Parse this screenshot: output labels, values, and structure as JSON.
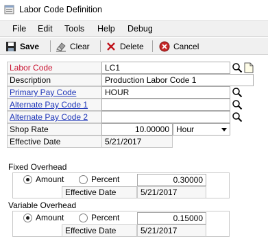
{
  "window": {
    "title": "Labor Code Definition"
  },
  "menu": {
    "file": "File",
    "edit": "Edit",
    "tools": "Tools",
    "help": "Help",
    "debug": "Debug"
  },
  "toolbar": {
    "save": "Save",
    "clear": "Clear",
    "delete": "Delete",
    "cancel": "Cancel"
  },
  "form": {
    "labor_code": {
      "label": "Labor Code",
      "value": "LC1"
    },
    "description": {
      "label": "Description",
      "value": "Production Labor Code 1"
    },
    "primary_pay_code": {
      "label": "Primary Pay Code",
      "value": "HOUR"
    },
    "alternate_pay_code_1": {
      "label": "Alternate Pay Code 1",
      "value": ""
    },
    "alternate_pay_code_2": {
      "label": "Alternate Pay Code 2",
      "value": ""
    },
    "shop_rate": {
      "label": "Shop Rate",
      "value": "10.00000",
      "unit": "Hour"
    },
    "effective_date": {
      "label": "Effective Date",
      "value": "5/21/2017"
    }
  },
  "fixed_overhead": {
    "title": "Fixed Overhead",
    "amount_label": "Amount",
    "percent_label": "Percent",
    "selected": "Amount",
    "value": "0.30000",
    "effective_date_label": "Effective Date",
    "effective_date": "5/21/2017"
  },
  "variable_overhead": {
    "title": "Variable Overhead",
    "amount_label": "Amount",
    "percent_label": "Percent",
    "selected": "Amount",
    "value": "0.15000",
    "effective_date_label": "Effective Date",
    "effective_date": "5/21/2017"
  },
  "colors": {
    "required_label": "#c8102e",
    "link_label": "#1d35b8"
  }
}
